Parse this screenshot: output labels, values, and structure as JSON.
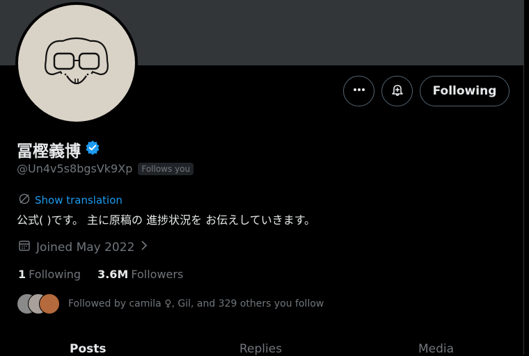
{
  "profile": {
    "display_name": "冨樫義博",
    "handle": "@Un4v5s8bgsVk9Xp",
    "follows_you": "Follows you",
    "translate_label": "Show translation",
    "bio": "公式( )です。 主に原稿の 進捗状況を お伝えしていきます。",
    "joined": "Joined May 2022",
    "verified": true
  },
  "actions": {
    "following_label": "Following",
    "more_icon": "more-icon",
    "bell_icon": "notification-bell-icon"
  },
  "stats": {
    "following_count": "1",
    "following_label": "Following",
    "followers_count": "3.6M",
    "followers_label": "Followers"
  },
  "followed_by": "Followed by camila ♀, Gil, and 329 others you follow",
  "tabs": {
    "posts": "Posts",
    "replies": "Replies",
    "media": "Media"
  },
  "colors": {
    "background": "#000000",
    "banner": "#333639",
    "accent": "#1d9bf0",
    "muted": "#71767b",
    "text": "#e7e9ea"
  }
}
